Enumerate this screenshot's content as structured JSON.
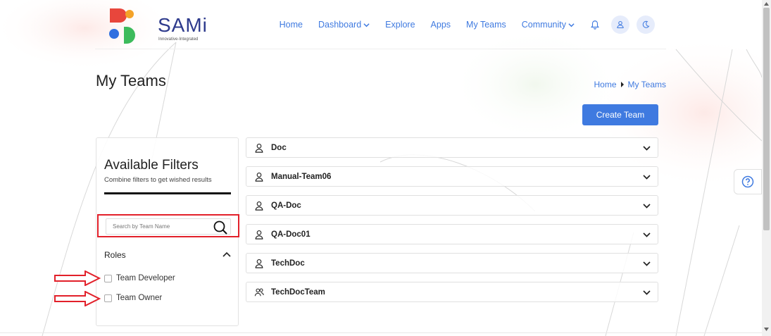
{
  "brand": {
    "name": "SAMi",
    "tagline": "Innovative-Integrated",
    "colors": {
      "orange": "#f4a228",
      "red": "#e8463c",
      "blue": "#2f6fe0",
      "green": "#3dbb5c",
      "navy": "#2d3a8c"
    }
  },
  "nav": {
    "items": [
      {
        "label": "Home",
        "dropdown": false
      },
      {
        "label": "Dashboard",
        "dropdown": true
      },
      {
        "label": "Explore",
        "dropdown": false
      },
      {
        "label": "Apps",
        "dropdown": false
      },
      {
        "label": "My Teams",
        "dropdown": false
      },
      {
        "label": "Community",
        "dropdown": true
      }
    ],
    "icons": [
      "bell-icon",
      "user-icon",
      "moon-icon"
    ]
  },
  "page": {
    "title": "My Teams"
  },
  "breadcrumb": {
    "home": "Home",
    "current": "My Teams"
  },
  "actions": {
    "create_team": "Create Team"
  },
  "filters": {
    "title": "Available Filters",
    "subtitle": "Combine filters to get wished results",
    "search_placeholder": "Search by Team Name",
    "roles_label": "Roles",
    "roles": [
      {
        "label": "Team Developer",
        "checked": false
      },
      {
        "label": "Team Owner",
        "checked": false
      }
    ]
  },
  "teams": [
    {
      "name": "Doc",
      "icon": "user-icon"
    },
    {
      "name": "Manual-Team06",
      "icon": "user-icon"
    },
    {
      "name": "QA-Doc",
      "icon": "user-icon"
    },
    {
      "name": "QA-Doc01",
      "icon": "user-icon"
    },
    {
      "name": "TechDoc",
      "icon": "user-icon"
    },
    {
      "name": "TechDocTeam",
      "icon": "users-icon"
    }
  ],
  "colors": {
    "accent": "#3f7ae0",
    "annotation": "#e2202a"
  }
}
